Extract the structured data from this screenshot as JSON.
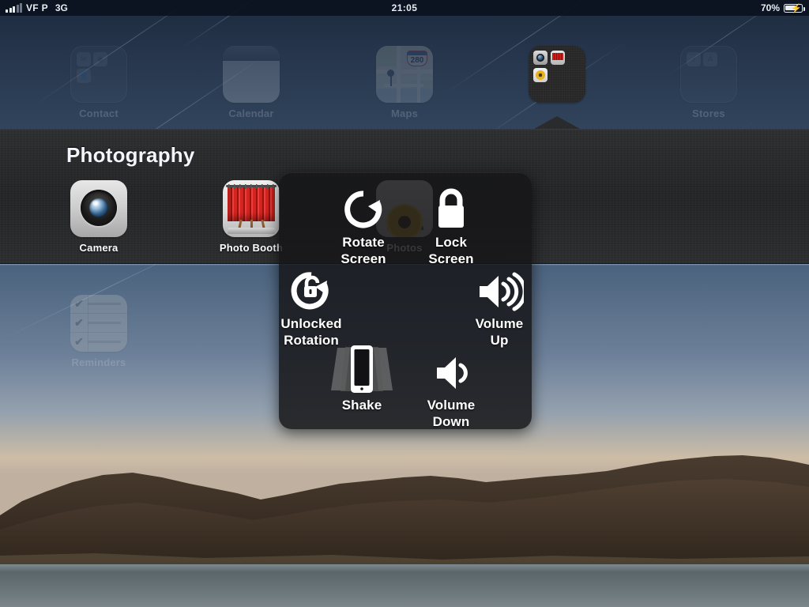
{
  "status_bar": {
    "signal_icon": "signal-bars-icon",
    "carrier": "VF P",
    "network": "3G",
    "time": "21:05",
    "battery_percent": "70%",
    "battery_icon": "battery-charging-icon"
  },
  "home_screen": {
    "apps": [
      {
        "name": "Contact",
        "label": "Contact",
        "icon": "folder-icon",
        "state": "dimmed"
      },
      {
        "name": "Calendar",
        "label": "Calendar",
        "icon": "calendar-icon",
        "state": "dimmed"
      },
      {
        "name": "Maps",
        "label": "Maps",
        "icon": "maps-icon",
        "state": "dimmed",
        "badge_text": "280"
      },
      {
        "name": "Photography",
        "label": "",
        "icon": "folder-open-icon",
        "state": "selected"
      },
      {
        "name": "Stores",
        "label": "Stores",
        "icon": "folder-icon",
        "state": "dimmed"
      },
      {
        "name": "Reminders",
        "label": "Reminders",
        "icon": "reminders-icon",
        "state": "dimmed"
      }
    ]
  },
  "folder": {
    "title": "Photography",
    "apps": [
      {
        "name": "Camera",
        "label": "Camera",
        "icon": "camera-icon"
      },
      {
        "name": "Photo Booth",
        "label": "Photo Booth",
        "icon": "photo-booth-icon"
      },
      {
        "name": "Photos",
        "label": "Photos",
        "icon": "photos-icon"
      }
    ]
  },
  "assistive_touch_menu": {
    "items": [
      {
        "name": "rotate-screen",
        "label": "Rotate\nScreen",
        "line1": "Rotate",
        "line2": "Screen",
        "icon": "rotate-screen-icon"
      },
      {
        "name": "lock-screen",
        "label": "Lock\nScreen",
        "line1": "Lock",
        "line2": "Screen",
        "icon": "padlock-closed-icon"
      },
      {
        "name": "unlocked-rotation",
        "label": "Unlocked\nRotation",
        "line1": "Unlocked",
        "line2": "Rotation",
        "icon": "rotation-unlocked-icon"
      },
      {
        "name": "volume-up",
        "label": "Volume\nUp",
        "line1": "Volume",
        "line2": "Up",
        "icon": "speaker-high-icon"
      },
      {
        "name": "shake",
        "label": "Shake",
        "line1": "Shake",
        "line2": "",
        "icon": "shake-device-icon"
      },
      {
        "name": "volume-down",
        "label": "Volume\nDown",
        "line1": "Volume",
        "line2": "Down",
        "icon": "speaker-low-icon"
      }
    ]
  },
  "colors": {
    "menu_background": "#161618",
    "folder_background": "#26282a",
    "text_primary": "#ffffff",
    "status_bar_background": "#0c121e",
    "selection_ring": "#f0f4fa"
  }
}
